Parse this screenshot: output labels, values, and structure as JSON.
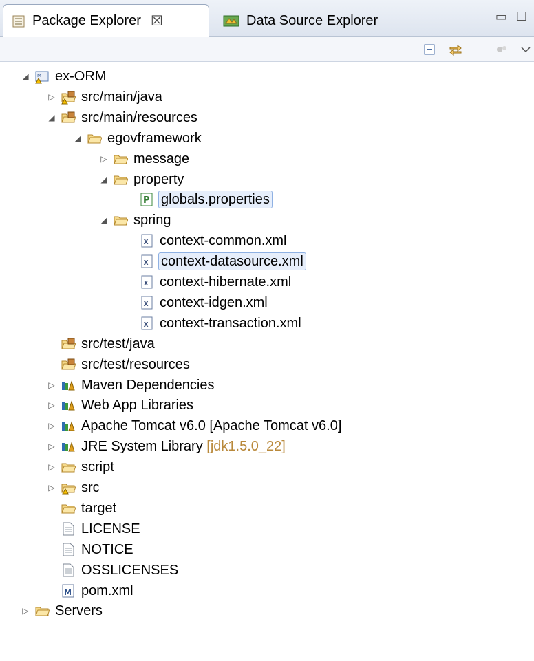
{
  "tabs": [
    {
      "label": "Package Explorer",
      "close": "☒",
      "active": true
    },
    {
      "label": "Data Source Explorer",
      "active": false
    }
  ],
  "window_controls": "▭ ☐",
  "toolbar": {
    "collapse_icon": "collapse-all-icon",
    "link_icon": "link-with-editor-icon",
    "other_icon": "view-menu-icon"
  },
  "tree": [
    {
      "label": "ex-ORM",
      "depth": 0,
      "twisty": "open",
      "icon": "maven-project-icon"
    },
    {
      "label": "src/main/java",
      "depth": 1,
      "twisty": "closed",
      "icon": "source-folder-warning-icon"
    },
    {
      "label": "src/main/resources",
      "depth": 1,
      "twisty": "open",
      "icon": "source-folder-icon"
    },
    {
      "label": "egovframework",
      "depth": 2,
      "twisty": "open",
      "icon": "folder-icon"
    },
    {
      "label": "message",
      "depth": 3,
      "twisty": "closed",
      "icon": "folder-icon"
    },
    {
      "label": "property",
      "depth": 3,
      "twisty": "open",
      "icon": "folder-icon"
    },
    {
      "label": "globals.properties",
      "depth": 4,
      "twisty": "none",
      "icon": "properties-file-icon",
      "selected": true
    },
    {
      "label": "spring",
      "depth": 3,
      "twisty": "open",
      "icon": "folder-icon"
    },
    {
      "label": "context-common.xml",
      "depth": 4,
      "twisty": "none",
      "icon": "xml-file-icon"
    },
    {
      "label": "context-datasource.xml",
      "depth": 4,
      "twisty": "none",
      "icon": "xml-file-icon",
      "selected": true
    },
    {
      "label": "context-hibernate.xml",
      "depth": 4,
      "twisty": "none",
      "icon": "xml-file-icon"
    },
    {
      "label": "context-idgen.xml",
      "depth": 4,
      "twisty": "none",
      "icon": "xml-file-icon"
    },
    {
      "label": "context-transaction.xml",
      "depth": 4,
      "twisty": "none",
      "icon": "xml-file-icon"
    },
    {
      "label": "src/test/java",
      "depth": 1,
      "twisty": "none",
      "icon": "source-folder-icon"
    },
    {
      "label": "src/test/resources",
      "depth": 1,
      "twisty": "none",
      "icon": "source-folder-icon"
    },
    {
      "label": "Maven Dependencies",
      "depth": 1,
      "twisty": "closed",
      "icon": "library-icon"
    },
    {
      "label": "Web App Libraries",
      "depth": 1,
      "twisty": "closed",
      "icon": "library-icon"
    },
    {
      "label": "Apache Tomcat v6.0 [Apache Tomcat v6.0]",
      "depth": 1,
      "twisty": "closed",
      "icon": "library-icon"
    },
    {
      "label": "JRE System Library",
      "decoration": "[jdk1.5.0_22]",
      "depth": 1,
      "twisty": "closed",
      "icon": "library-icon"
    },
    {
      "label": "script",
      "depth": 1,
      "twisty": "closed",
      "icon": "folder-icon"
    },
    {
      "label": "src",
      "depth": 1,
      "twisty": "closed",
      "icon": "folder-warning-icon"
    },
    {
      "label": "target",
      "depth": 1,
      "twisty": "none",
      "icon": "folder-icon"
    },
    {
      "label": "LICENSE",
      "depth": 1,
      "twisty": "none",
      "icon": "text-file-icon"
    },
    {
      "label": "NOTICE",
      "depth": 1,
      "twisty": "none",
      "icon": "text-file-icon"
    },
    {
      "label": "OSSLICENSES",
      "depth": 1,
      "twisty": "none",
      "icon": "text-file-icon"
    },
    {
      "label": "pom.xml",
      "depth": 1,
      "twisty": "none",
      "icon": "maven-pom-icon"
    },
    {
      "label": "Servers",
      "depth": 0,
      "twisty": "closed",
      "icon": "folder-icon"
    }
  ]
}
